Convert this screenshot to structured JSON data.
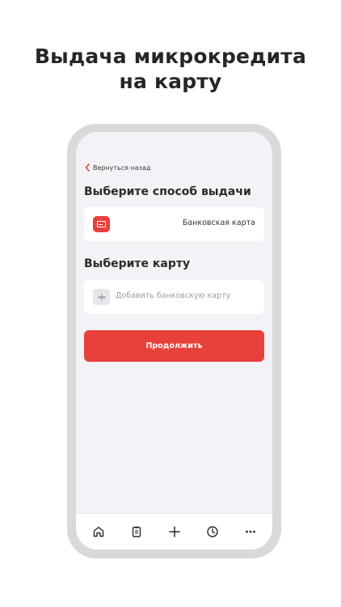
{
  "promo": {
    "title_line1": "Выдача микрокредита",
    "title_line2": "на карту"
  },
  "screen": {
    "back_label": "Вернуться назад",
    "payout_heading": "Выберите способ выдачи",
    "payout_option": {
      "label": "Банковская карта",
      "icon": "bank-card-icon"
    },
    "card_heading": "Выберите карту",
    "add_card": {
      "label": "Добавить банковскую карту",
      "icon": "plus-icon"
    },
    "continue_label": "Продолжить"
  },
  "tab_bar": {
    "items": [
      {
        "icon": "home-icon"
      },
      {
        "icon": "clipboard-icon"
      },
      {
        "icon": "plus-icon"
      },
      {
        "icon": "clock-icon"
      },
      {
        "icon": "more-icon"
      }
    ]
  },
  "colors": {
    "accent": "#e8403a",
    "screen_bg": "#f3f3f7",
    "frame": "#d9d9db",
    "text_dark": "#2b2b2b",
    "placeholder": "#9c9ca3"
  }
}
